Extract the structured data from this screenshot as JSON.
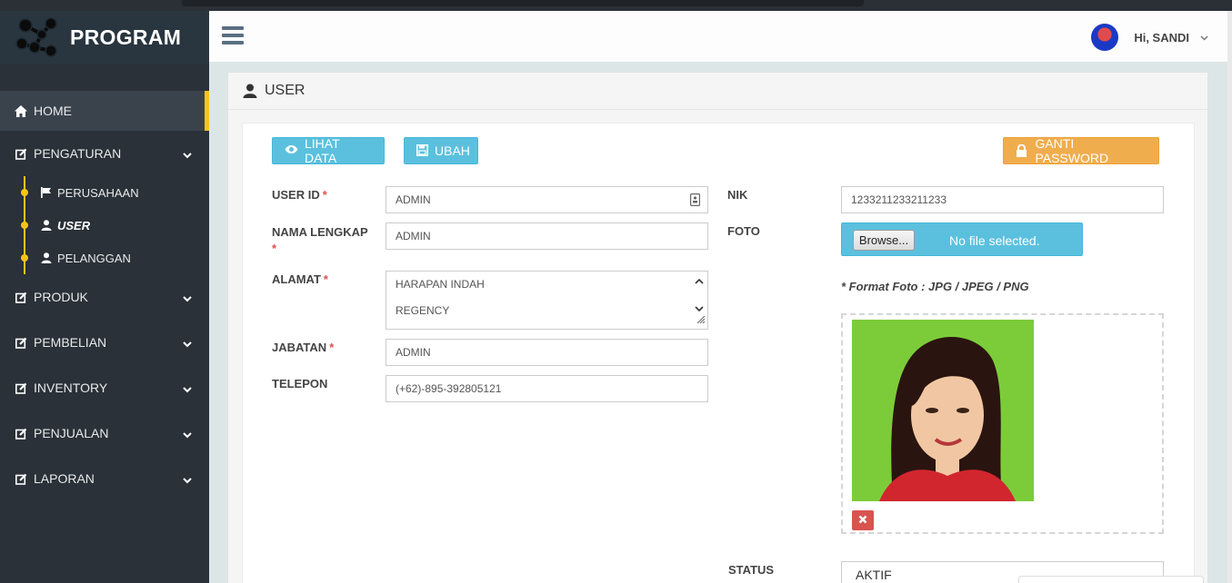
{
  "brand": {
    "title": "PROGRAM"
  },
  "sidebar": {
    "items": [
      {
        "label": "HOME",
        "icon": "home-icon"
      },
      {
        "label": "PENGATURAN",
        "icon": "edit-icon"
      },
      {
        "label": "PRODUK",
        "icon": "edit-icon"
      },
      {
        "label": "PEMBELIAN",
        "icon": "edit-icon"
      },
      {
        "label": "INVENTORY",
        "icon": "edit-icon"
      },
      {
        "label": "PENJUALAN",
        "icon": "edit-icon"
      },
      {
        "label": "LAPORAN",
        "icon": "edit-icon"
      }
    ],
    "submenu": [
      {
        "label": "PERUSAHAAN",
        "icon": "flag-icon"
      },
      {
        "label": "USER",
        "icon": "user-icon"
      },
      {
        "label": "PELANGGAN",
        "icon": "user-icon"
      }
    ]
  },
  "header": {
    "greeting": "Hi, SANDI"
  },
  "panel": {
    "title": "USER"
  },
  "buttons": {
    "view": "LIHAT DATA",
    "edit": "UBAH",
    "password": "GANTI PASSWORD"
  },
  "form": {
    "user_id": {
      "label": "USER ID",
      "value": "ADMIN"
    },
    "full_name": {
      "label": "NAMA LENGKAP",
      "value": "ADMIN"
    },
    "address": {
      "label": "ALAMAT",
      "line1": "HARAPAN INDAH",
      "line2": "REGENCY"
    },
    "position": {
      "label": "JABATAN",
      "value": "ADMIN"
    },
    "phone": {
      "label": "TELEPON",
      "value": "(+62)-895-392805121"
    },
    "nik": {
      "label": "NIK",
      "value": "1233211233211233"
    },
    "photo": {
      "label": "FOTO",
      "browse": "Browse...",
      "status": "No file selected.",
      "note": "* Format Foto : JPG / JPEG / PNG"
    },
    "status": {
      "label": "STATUS",
      "value": "AKTIF"
    }
  },
  "colors": {
    "sidebar_bg": "#2a3138",
    "accent_yellow": "#f5c518",
    "info": "#5bc0de",
    "warning": "#f0ad4e",
    "danger": "#d9534f"
  }
}
